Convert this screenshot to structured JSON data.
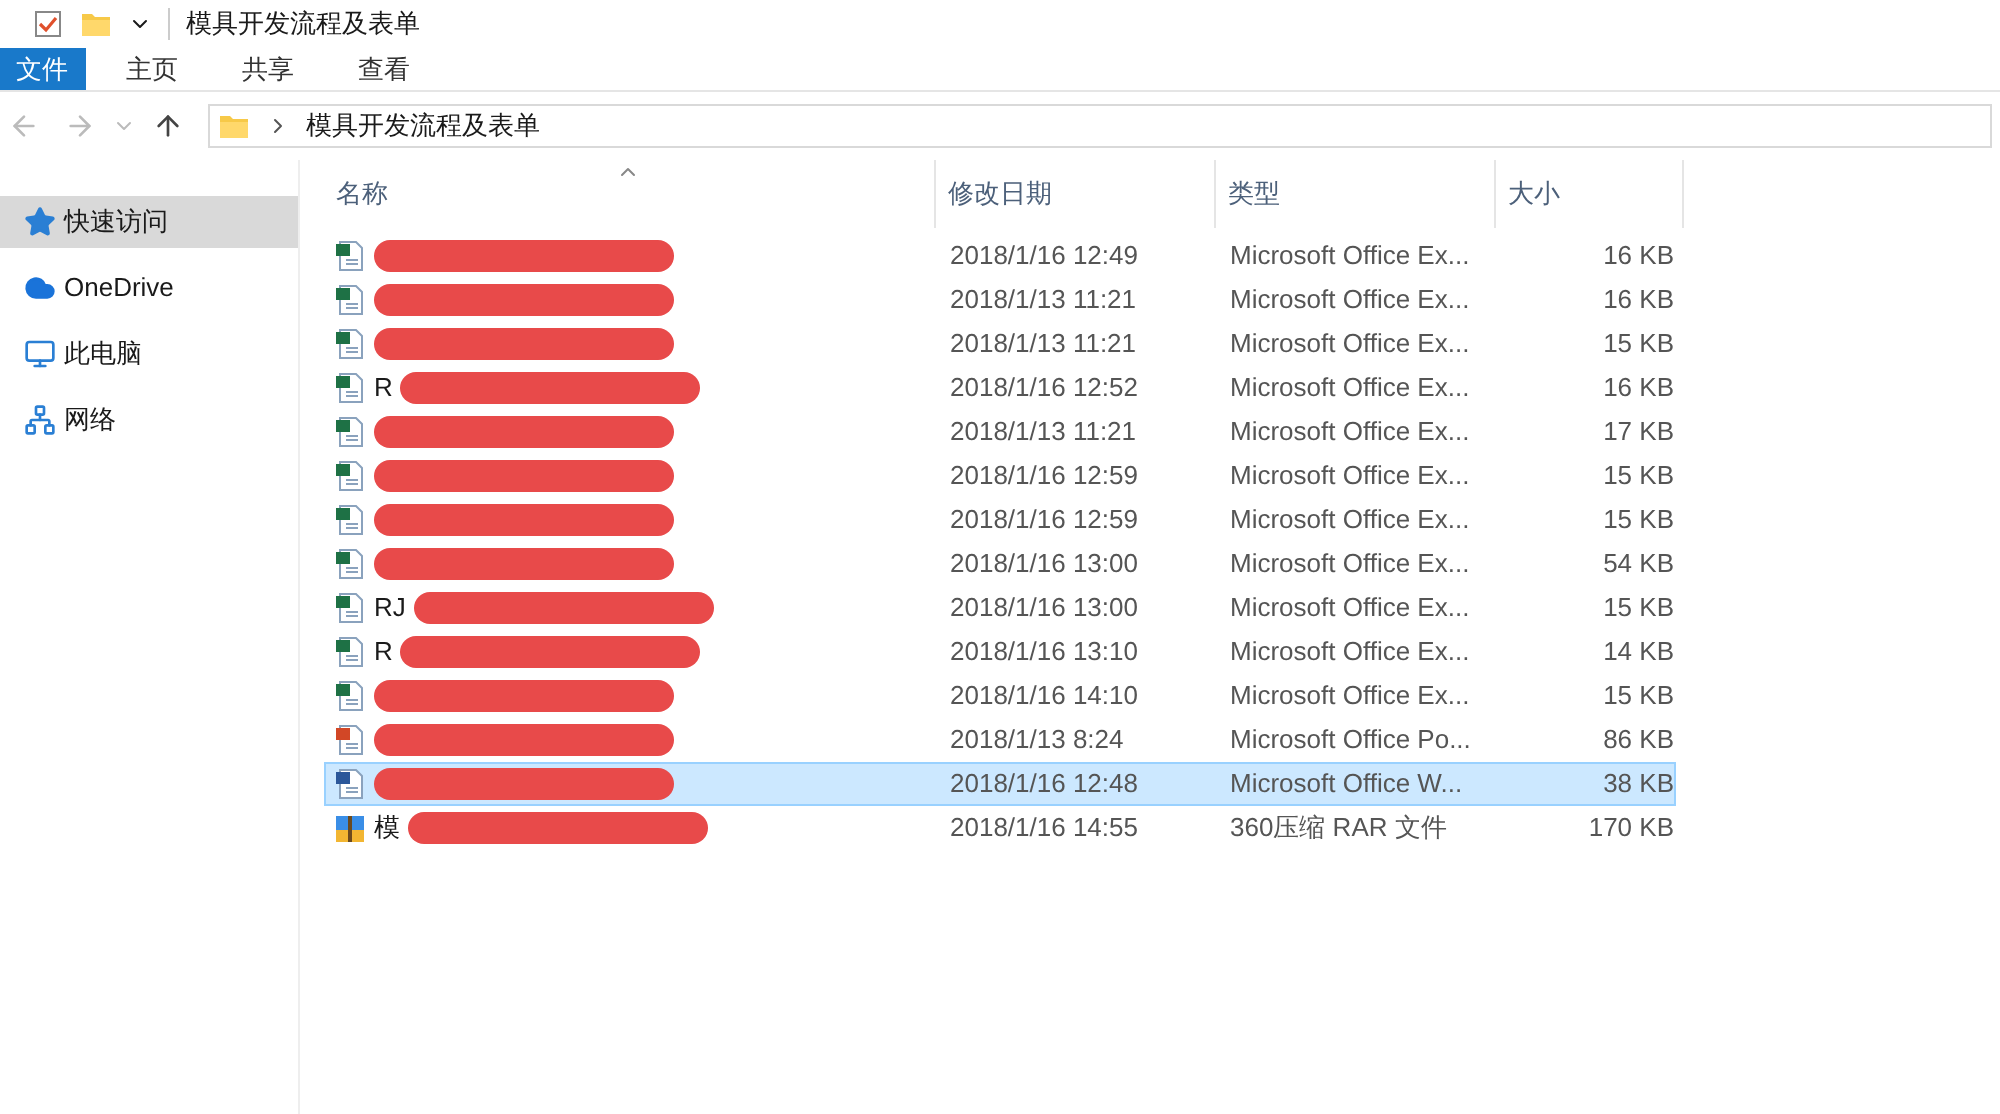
{
  "window": {
    "title": "模具开发流程及表单"
  },
  "ribbon_tabs": [
    {
      "label": "文件",
      "selected": true
    },
    {
      "label": "主页",
      "selected": false
    },
    {
      "label": "共享",
      "selected": false
    },
    {
      "label": "查看",
      "selected": false
    }
  ],
  "address": {
    "path": "模具开发流程及表单"
  },
  "sidebar": {
    "items": [
      {
        "label": "快速访问",
        "kind": "star",
        "selected": true
      },
      {
        "label": "OneDrive",
        "kind": "cloud",
        "selected": false
      },
      {
        "label": "此电脑",
        "kind": "pc",
        "selected": false
      },
      {
        "label": "网络",
        "kind": "network",
        "selected": false
      }
    ]
  },
  "table": {
    "columns": [
      "名称",
      "修改日期",
      "类型",
      "大小"
    ],
    "rows": [
      {
        "kind": "excel",
        "date": "2018/1/16 12:49",
        "type": "Microsoft Office Ex...",
        "size": "16 KB",
        "selected": false
      },
      {
        "kind": "excel",
        "date": "2018/1/13 11:21",
        "type": "Microsoft Office Ex...",
        "size": "16 KB",
        "selected": false
      },
      {
        "kind": "excel",
        "date": "2018/1/13 11:21",
        "type": "Microsoft Office Ex...",
        "size": "15 KB",
        "selected": false
      },
      {
        "kind": "excel",
        "name": "R",
        "date": "2018/1/16 12:52",
        "type": "Microsoft Office Ex...",
        "size": "16 KB",
        "selected": false
      },
      {
        "kind": "excel",
        "date": "2018/1/13 11:21",
        "type": "Microsoft Office Ex...",
        "size": "17 KB",
        "selected": false
      },
      {
        "kind": "excel",
        "date": "2018/1/16 12:59",
        "type": "Microsoft Office Ex...",
        "size": "15 KB",
        "selected": false
      },
      {
        "kind": "excel",
        "date": "2018/1/16 12:59",
        "type": "Microsoft Office Ex...",
        "size": "15 KB",
        "selected": false
      },
      {
        "kind": "excel",
        "date": "2018/1/16 13:00",
        "type": "Microsoft Office Ex...",
        "size": "54 KB",
        "selected": false
      },
      {
        "kind": "excel",
        "name": "RJ",
        "date": "2018/1/16 13:00",
        "type": "Microsoft Office Ex...",
        "size": "15 KB",
        "selected": false
      },
      {
        "kind": "excel",
        "name": "R",
        "date": "2018/1/16 13:10",
        "type": "Microsoft Office Ex...",
        "size": "14 KB",
        "selected": false
      },
      {
        "kind": "excel",
        "date": "2018/1/16 14:10",
        "type": "Microsoft Office Ex...",
        "size": "15 KB",
        "selected": false
      },
      {
        "kind": "powerpoint",
        "date": "2018/1/13 8:24",
        "type": "Microsoft Office Po...",
        "size": "86 KB",
        "selected": false
      },
      {
        "kind": "word",
        "date": "2018/1/16 12:48",
        "type": "Microsoft Office W...",
        "size": "38 KB",
        "selected": true
      },
      {
        "kind": "archive",
        "name": "模",
        "date": "2018/1/16 14:55",
        "type": "360压缩 RAR 文件",
        "size": "170 KB",
        "selected": false
      }
    ]
  }
}
